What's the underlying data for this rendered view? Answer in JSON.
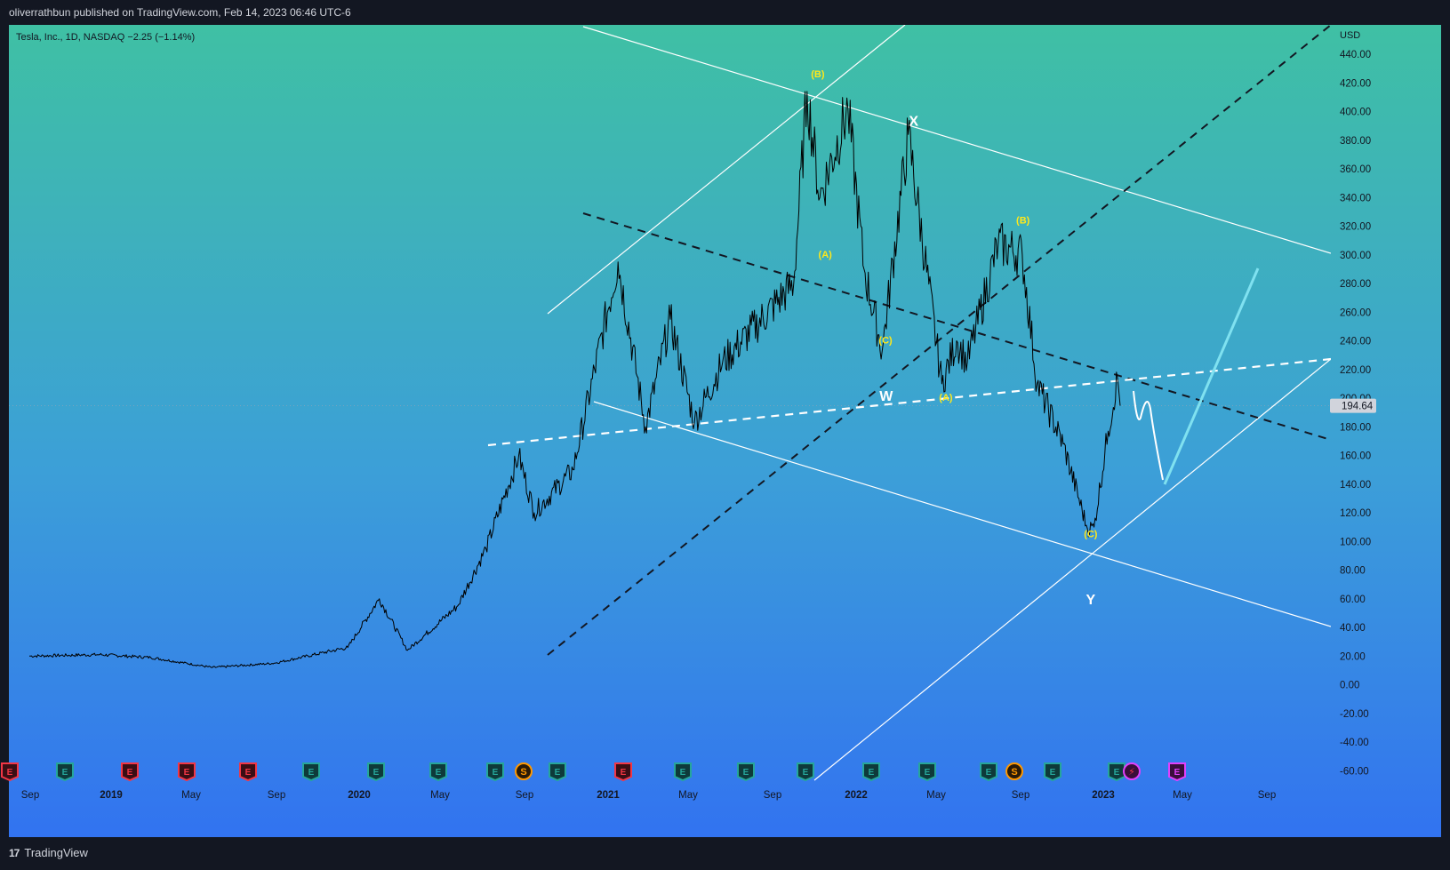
{
  "header": {
    "publisher_line": "oliverrathbun published on TradingView.com, Feb 14, 2023 06:46 UTC-6"
  },
  "legend": {
    "text": "Tesla, Inc., 1D, NASDAQ  −2.25 (−1.14%)"
  },
  "footer": {
    "brand": "TradingView",
    "logo_mark": "17"
  },
  "colors": {
    "background": "#131722",
    "gradient_top": "#3fc0a4",
    "gradient_bottom": "#3273f0",
    "price_line": "#000000",
    "wave_label": "#ffe81a",
    "projection": "#7fe1f0"
  },
  "chart_data": {
    "type": "line",
    "title": "Tesla, Inc., 1D, NASDAQ",
    "currency": "USD",
    "ylim": [
      -60,
      450
    ],
    "y_ticks": [
      440,
      420,
      400,
      380,
      360,
      340,
      320,
      300,
      280,
      260,
      240,
      220,
      200,
      180,
      160,
      140,
      120,
      100,
      80,
      60,
      40,
      20,
      0,
      -20,
      -40,
      -60
    ],
    "last_price": "194.64",
    "x_ticks": [
      "Sep",
      "2019",
      "May",
      "Sep",
      "2020",
      "May",
      "Sep",
      "2021",
      "May",
      "Sep",
      "2022",
      "May",
      "Sep",
      "2023",
      "May",
      "Sep"
    ],
    "series": [
      {
        "values": [
          [
            "2018-09-01",
            20
          ],
          [
            "2018-12-15",
            21
          ],
          [
            "2019-03-01",
            19
          ],
          [
            "2019-06-01",
            12
          ],
          [
            "2019-09-01",
            15
          ],
          [
            "2019-12-20",
            26
          ],
          [
            "2020-02-05",
            60
          ],
          [
            "2020-03-18",
            24
          ],
          [
            "2020-06-01",
            55
          ],
          [
            "2020-07-13",
            95
          ],
          [
            "2020-08-31",
            160
          ],
          [
            "2020-09-23",
            120
          ],
          [
            "2020-11-20",
            150
          ],
          [
            "2021-01-26",
            295
          ],
          [
            "2021-03-08",
            180
          ],
          [
            "2021-04-14",
            255
          ],
          [
            "2021-05-20",
            183
          ],
          [
            "2021-07-01",
            225
          ],
          [
            "2021-10-15",
            280
          ],
          [
            "2021-11-04",
            414
          ],
          [
            "2021-11-23",
            340
          ],
          [
            "2022-01-04",
            402
          ],
          [
            "2022-01-28",
            290
          ],
          [
            "2022-02-24",
            233
          ],
          [
            "2022-04-04",
            384
          ],
          [
            "2022-05-24",
            210
          ],
          [
            "2022-06-15",
            240
          ],
          [
            "2022-07-01",
            225
          ],
          [
            "2022-08-16",
            308
          ],
          [
            "2022-09-21",
            300
          ],
          [
            "2022-10-13",
            210
          ],
          [
            "2022-11-21",
            168
          ],
          [
            "2022-12-27",
            109
          ],
          [
            "2023-01-06",
            110
          ],
          [
            "2023-01-27",
            177
          ],
          [
            "2023-02-10",
            214
          ],
          [
            "2023-02-14",
            194.64
          ]
        ]
      }
    ],
    "annotations": [
      {
        "text": "(B)",
        "x": "2021-11-20",
        "y": 424
      },
      {
        "text": "(A)",
        "x": "2021-12-01",
        "y": 298
      },
      {
        "text": "(C)",
        "x": "2022-03-01",
        "y": 238
      },
      {
        "text": "X",
        "x": "2022-04-12",
        "y": 390
      },
      {
        "text": "W",
        "x": "2022-03-02",
        "y": 198
      },
      {
        "text": "(A)",
        "x": "2022-05-30",
        "y": 198
      },
      {
        "text": "(B)",
        "x": "2022-09-22",
        "y": 322
      },
      {
        "text": "(C)",
        "x": "2023-01-01",
        "y": 103
      },
      {
        "text": "Y",
        "x": "2023-01-01",
        "y": 56
      }
    ],
    "events": [
      "E",
      "E",
      "E",
      "E",
      "E",
      "E",
      "E",
      "E",
      "E",
      "S",
      "E",
      "E",
      "E",
      "E",
      "E",
      "E",
      "E",
      "E",
      "S",
      "E",
      "E",
      "⚡",
      "E"
    ]
  }
}
